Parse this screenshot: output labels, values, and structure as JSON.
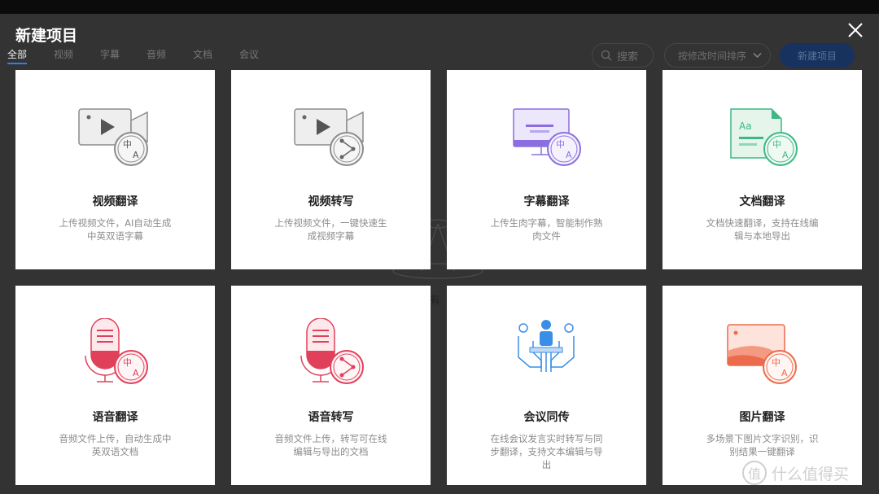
{
  "dialog": {
    "title": "新建项目"
  },
  "tabs": [
    {
      "label": "全部"
    },
    {
      "label": "视频"
    },
    {
      "label": "字幕"
    },
    {
      "label": "音频"
    },
    {
      "label": "文档"
    },
    {
      "label": "会议"
    }
  ],
  "toolbar": {
    "search_label": "搜索",
    "sort_label": "按修改时间排序",
    "new_label": "新建项目"
  },
  "cards": [
    {
      "name": "视频翻译",
      "desc": "上传视频文件，AI自动生成中英双语字幕",
      "icon": "video-translate-icon"
    },
    {
      "name": "视频转写",
      "desc": "上传视频文件，一键快速生成视频字幕",
      "icon": "video-transcribe-icon"
    },
    {
      "name": "字幕翻译",
      "desc": "上传生肉字幕，智能制作熟肉文件",
      "icon": "subtitle-translate-icon"
    },
    {
      "name": "文档翻译",
      "desc": "文档快速翻译，支持在线编辑与本地导出",
      "icon": "document-translate-icon"
    },
    {
      "name": "语音翻译",
      "desc": "音频文件上传，自动生成中英双语文档",
      "icon": "voice-translate-icon"
    },
    {
      "name": "语音转写",
      "desc": "音频文件上传，转写可在线编辑与导出的文档",
      "icon": "voice-transcribe-icon"
    },
    {
      "name": "会议同传",
      "desc": "在线会议发言实时转写与同步翻译，支持文本编辑与导出",
      "icon": "meeting-interpret-icon"
    },
    {
      "name": "图片翻译",
      "desc": "多场景下图片文字识别，识别结果一键翻译",
      "icon": "image-translate-icon"
    }
  ],
  "watermark": {
    "text": "有",
    "site": "什么值得买",
    "site_glyph": "值"
  },
  "colors": {
    "accent": "#2f7cf6",
    "video": "#8c8c8c",
    "subtitle": "#8b6fe0",
    "document": "#3db884",
    "voice": "#e0405a",
    "meeting": "#3a8ee6",
    "image": "#ec6b4c"
  }
}
